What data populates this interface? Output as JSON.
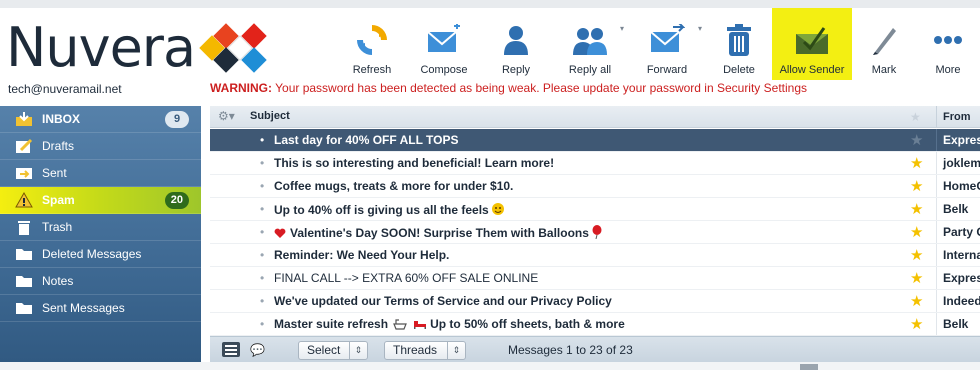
{
  "app": {
    "logo_text": "Nuvera",
    "account": "tech@nuveramail.net",
    "warning_label": "WARNING:",
    "warning_text": " Your password has been detected as being weak. Please update your password in Security Settings"
  },
  "toolbar": {
    "refresh": "Refresh",
    "compose": "Compose",
    "reply": "Reply",
    "reply_all": "Reply all",
    "forward": "Forward",
    "delete": "Delete",
    "allow_sender": "Allow Sender",
    "mark": "Mark",
    "more": "More",
    "highlight_color": "#f3ef12"
  },
  "sidebar": {
    "items": [
      {
        "label": "INBOX",
        "icon": "inbox-icon",
        "badge": "9"
      },
      {
        "label": "Drafts",
        "icon": "drafts-icon"
      },
      {
        "label": "Sent",
        "icon": "sent-icon"
      },
      {
        "label": "Spam",
        "icon": "warning-icon",
        "badge": "20"
      },
      {
        "label": "Trash",
        "icon": "trash-icon"
      },
      {
        "label": "Deleted Messages",
        "icon": "folder-icon"
      },
      {
        "label": "Notes",
        "icon": "folder-icon"
      },
      {
        "label": "Sent Messages",
        "icon": "folder-icon"
      }
    ]
  },
  "list": {
    "col_subject": "Subject",
    "col_from": "From",
    "rows": [
      {
        "subject": "Last day for 40% OFF ALL TOPS",
        "from": "Express",
        "selected": true
      },
      {
        "subject": "This is so interesting and beneficial! Learn more!",
        "from": "joklem"
      },
      {
        "subject": "Coffee mugs, treats & more for under $10.",
        "from": "HomeG"
      },
      {
        "subject": "Up to 40% off is giving us all the feels",
        "from": "Belk",
        "emoji": "hug"
      },
      {
        "subject": "Valentine's Day SOON! Surprise Them with Balloons",
        "from": "Party C",
        "emoji": "heart-balloon"
      },
      {
        "subject": "Reminder: We Need Your Help.",
        "from": "Interna"
      },
      {
        "subject": "FINAL CALL --> EXTRA 60% OFF SALE ONLINE",
        "from": "Expres"
      },
      {
        "subject": "We've updated our Terms of Service and our Privacy Policy",
        "from": "Indeed"
      },
      {
        "subject_a": "Master suite refresh",
        "subject_b": "Up to 50% off sheets, bath & more",
        "from": "Belk",
        "emoji": "bath-bed"
      }
    ]
  },
  "footer": {
    "select_label": "Select",
    "threads_label": "Threads",
    "count_text": "Messages 1 to 23 of 23"
  }
}
